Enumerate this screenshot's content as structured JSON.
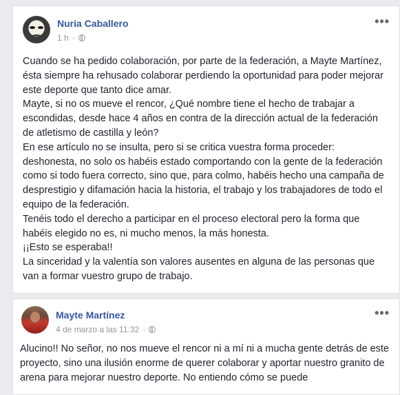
{
  "post": {
    "author": "Nuria Caballero",
    "time": "1 h",
    "more": "•••",
    "paragraphs": [
      "Cuando se ha pedido colaboración, por parte de la federación, a Mayte Martínez, ésta siempre ha rehusado colaborar perdiendo la oportunidad para poder mejorar este deporte que tanto dice amar.",
      "Mayte, si no os mueve el rencor, ¿Qué nombre tiene el hecho de trabajar a escondidas, desde hace 4 años en contra de la dirección actual de la federación de atletismo de castilla y león?",
      "En ese artículo no se insulta, pero si se critica vuestra forma proceder: deshonesta, no solo os habéis estado comportando con la gente de la federación como si todo fuera correcto, sino que, para colmo, habéis hecho una campaña de desprestigio y difamación hacia la historia, el trabajo y los trabajadores de todo el equipo de la federación.",
      "Tenéis todo el derecho a participar en el proceso electoral pero la forma que habéis elegido no es, ni mucho menos, la más honesta.",
      "¡¡Esto se esperaba!!",
      "La sinceridad y la valentía son valores ausentes en alguna de las personas que van a formar vuestro grupo de trabajo."
    ]
  },
  "reply": {
    "author": "Mayte Martínez",
    "time": "4 de marzo a las 11:32",
    "more": "•••",
    "text": "Alucino!! No señor, no nos mueve el rencor ni a mí ni a mucha gente detrás de este proyecto, sino una ilusión enorme de querer colaborar y aportar nuestro granito de arena para mejorar nuestro deporte. No entiendo cómo se puede"
  }
}
